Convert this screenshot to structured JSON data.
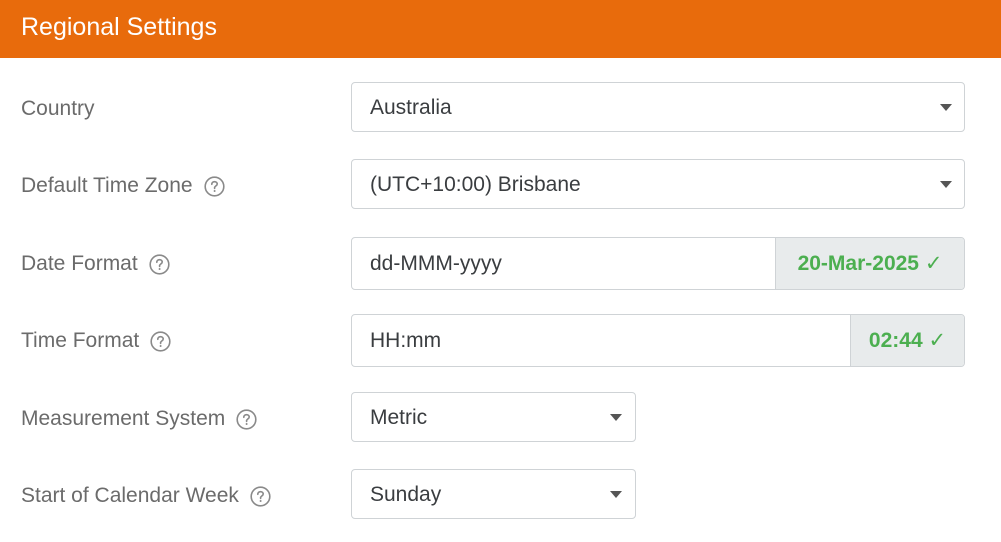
{
  "header": {
    "title": "Regional Settings"
  },
  "fields": {
    "country": {
      "label": "Country",
      "value": "Australia"
    },
    "timezone": {
      "label": "Default Time Zone",
      "value": "(UTC+10:00) Brisbane"
    },
    "date_format": {
      "label": "Date Format",
      "value": "dd-MMM-yyyy",
      "preview": "20-Mar-2025 ✓"
    },
    "time_format": {
      "label": "Time Format",
      "value": "HH:mm",
      "preview": "02:44 ✓"
    },
    "measurement": {
      "label": "Measurement System",
      "value": "Metric"
    },
    "week_start": {
      "label": "Start of Calendar Week",
      "value": "Sunday"
    }
  },
  "icons": {
    "help": "question-circle-icon",
    "dropdown": "caret-down-icon"
  },
  "colors": {
    "header_bg": "#e86b0c",
    "preview_ok": "#4caf50"
  }
}
